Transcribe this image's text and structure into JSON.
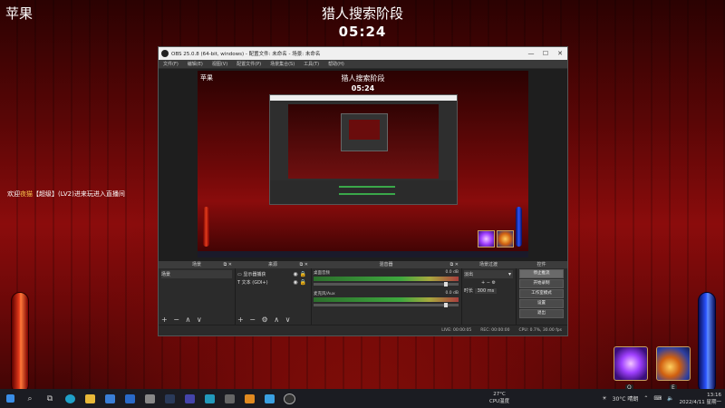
{
  "game": {
    "corner_label": "苹果",
    "title": "猎人搜索阶段",
    "timer": "05:24",
    "chat_prefix": "欢迎",
    "chat_name": "夜猫",
    "chat_text": "【超级】(LV2)进来玩进入直播间",
    "skill1_key": "Q",
    "skill2_key": "E"
  },
  "obs": {
    "title": "OBS 25.0.8 (64-bit, windows) - 配置文件: 未命名 - 场景: 未命名",
    "menu": [
      "文件(F)",
      "编辑(E)",
      "视图(V)",
      "配置文件(P)",
      "场景集合(S)",
      "工具(T)",
      "帮助(H)"
    ],
    "preview": {
      "title": "猎人搜索阶段",
      "timer": "05:24",
      "corner_label": "苹果"
    },
    "docks": {
      "scenes": {
        "header": "场景",
        "item": "场景"
      },
      "sources": {
        "header": "来源",
        "items": [
          "显示器捕获",
          "文本 (GDI+)"
        ]
      },
      "mixer": {
        "header": "混音器",
        "channels": [
          {
            "name": "桌面音频",
            "db": "0.0 dB"
          },
          {
            "name": "麦克风/Aux",
            "db": "0.0 dB"
          }
        ]
      },
      "transitions": {
        "header": "场景过渡",
        "type": "淡出",
        "duration_label": "时长",
        "duration": "300 ms"
      },
      "controls": {
        "header": "控件",
        "buttons": [
          "停止推流",
          "开始录制",
          "工作室模式",
          "设置",
          "退出"
        ]
      }
    },
    "status": {
      "live": "LIVE: 00:00:05",
      "rec": "REC: 00:00:00",
      "cpu": "CPU: 0.7%, 30.00 fps"
    }
  },
  "taskbar": {
    "weather_temp": "27°C",
    "weather_desc": "CPU温度",
    "tray_weather": "30°C 晴朗",
    "time": "13:16",
    "date": "2022/4/11 星期一"
  },
  "colors": {
    "background": "#6b0808",
    "obs_panel": "#2b2b2b",
    "red_gauge": "#e33a1b",
    "blue_gauge": "#2a54ff"
  }
}
